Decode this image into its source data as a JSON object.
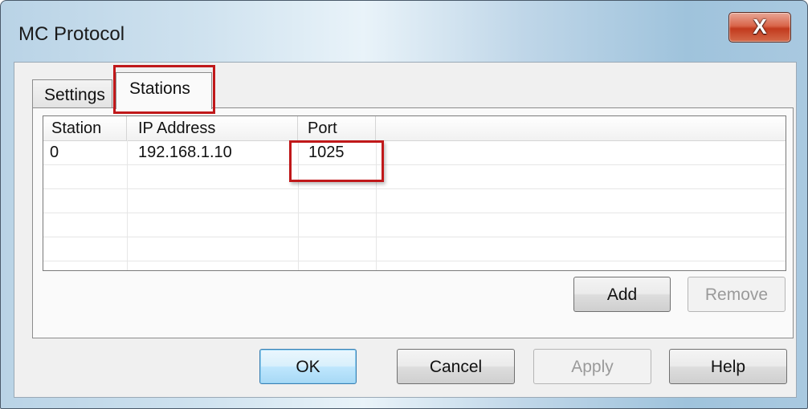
{
  "window": {
    "title": "MC Protocol",
    "close_label": "X"
  },
  "tabs": [
    {
      "label": "Settings",
      "selected": false
    },
    {
      "label": "Stations",
      "selected": true
    }
  ],
  "table": {
    "columns": [
      "Station",
      "IP Address",
      "Port"
    ],
    "rows": [
      {
        "station": "0",
        "ip": "192.168.1.10",
        "port": "1025"
      }
    ]
  },
  "panel_buttons": {
    "add": "Add",
    "remove": "Remove"
  },
  "dialog_buttons": {
    "ok": "OK",
    "cancel": "Cancel",
    "apply": "Apply",
    "help": "Help"
  },
  "colors": {
    "highlight": "#c0181a",
    "close_button": "#c23a1e",
    "default_button": "#3c7fb1"
  }
}
